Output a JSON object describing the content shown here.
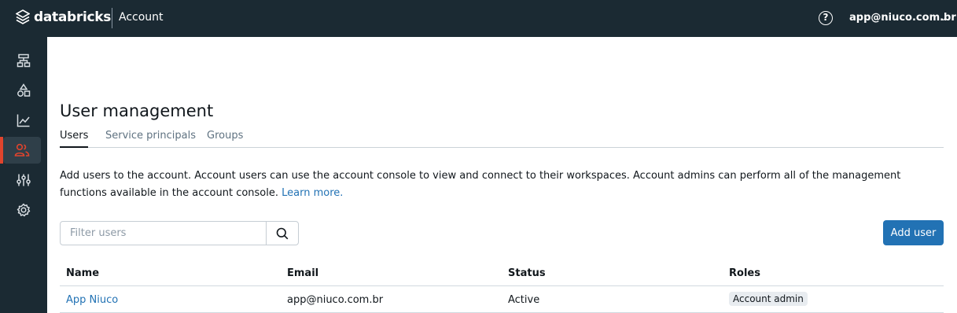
{
  "topbar": {
    "brand": "databricks",
    "product": "Account",
    "help_icon": "question-circle-icon",
    "account_email": "app@niuco.com.br"
  },
  "sidebar": {
    "items": [
      {
        "name": "workspaces",
        "icon": "workspaces-icon",
        "active": false
      },
      {
        "name": "data",
        "icon": "shapes-icon",
        "active": false
      },
      {
        "name": "usage",
        "icon": "line-chart-icon",
        "active": false
      },
      {
        "name": "user-management",
        "icon": "users-icon",
        "active": true
      },
      {
        "name": "previews",
        "icon": "sliders-icon",
        "active": false
      },
      {
        "name": "settings",
        "icon": "gear-icon",
        "active": false
      }
    ],
    "active_color": "#e0442d"
  },
  "page": {
    "title": "User management",
    "tabs": [
      "Users",
      "Service principals",
      "Groups"
    ],
    "active_tab": "Users",
    "description": "Add users to the account. Account users can use the account console to view and connect to their workspaces. Account admins can perform all of the management functions available in the account console.",
    "learn_more": "Learn more."
  },
  "filter": {
    "placeholder": "Filter users",
    "value": ""
  },
  "add_button": "Add user",
  "table": {
    "headers": [
      "Name",
      "Email",
      "Status",
      "Roles"
    ],
    "rows": [
      {
        "name": "App Niuco",
        "email": "app@niuco.com.br",
        "status": "Active",
        "role": "Account admin"
      }
    ]
  },
  "colors": {
    "topbar_bg": "#1b2a33",
    "primary": "#2272b4"
  }
}
